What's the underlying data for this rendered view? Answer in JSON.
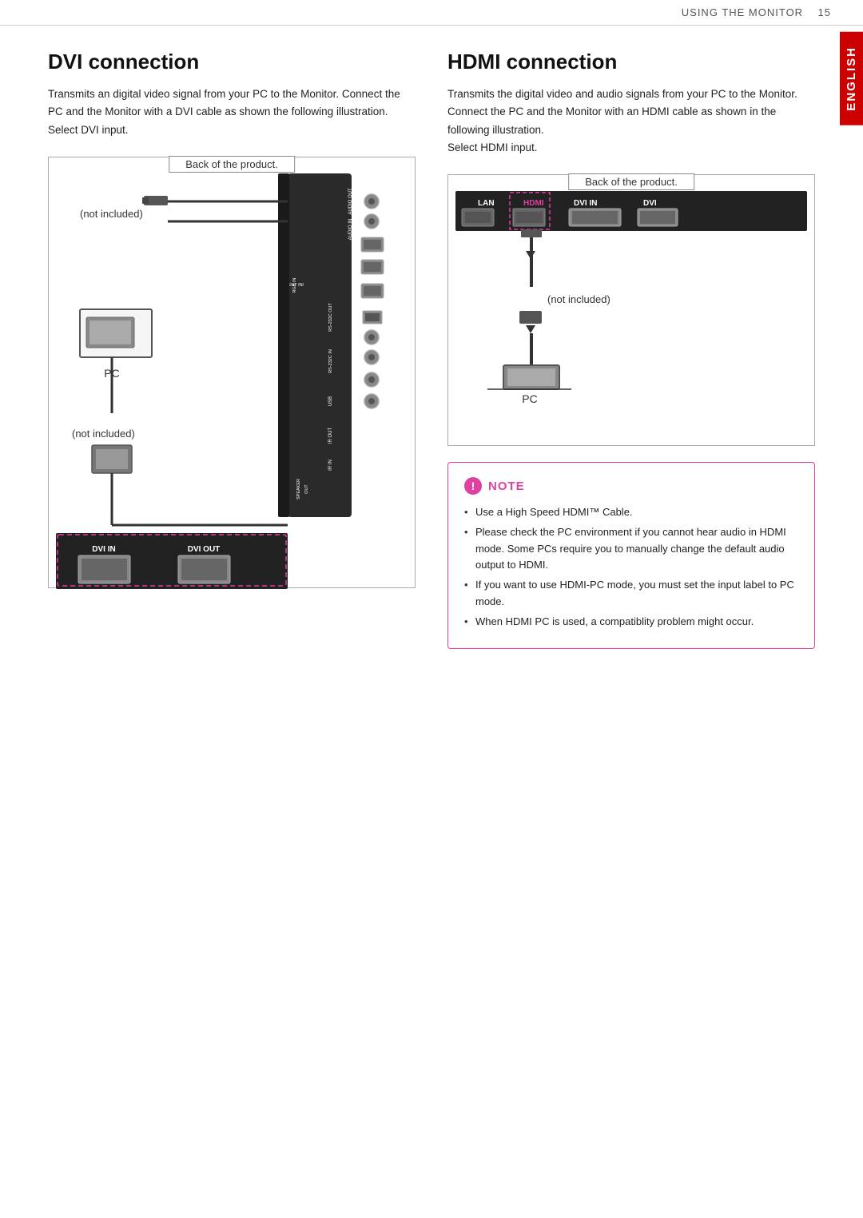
{
  "header": {
    "text": "USING THE MONITOR",
    "page_number": "15"
  },
  "english_tab": "ENGLISH",
  "dvi_section": {
    "title": "DVI connection",
    "description": "Transmits an digital video signal from your PC to the Monitor. Connect the PC and the Monitor with a DVI cable as shown the following illustration. Select DVI input.",
    "diagram_label": "Back of the product.",
    "not_included_1": "(not included)",
    "not_included_2": "(not included)",
    "pc_label": "PC",
    "port_labels": {
      "audio_out": "AUDIO OUT",
      "audio_in": "AUDIO IN",
      "component_rgb": "COMPONENT IN/ RGB IN",
      "rs232c_out": "RS-232C OUT",
      "rs232c_in": "RS-232C IN",
      "usb": "USB",
      "ir_out": "IR OUT",
      "ir_in": "IR IN",
      "speaker_out": "SPEAKER OUT"
    },
    "bottom_labels": {
      "dvi_in": "DVI IN",
      "dvi_out": "DVI OUT"
    }
  },
  "hdmi_section": {
    "title": "HDMI connection",
    "description": "Transmits the digital video and audio signals from your PC to the Monitor. Connect the PC and the Monitor with an HDMI cable as shown in the following illustration.\nSelect HDMI input.",
    "diagram_label": "Back of the product.",
    "not_included": "(not included)",
    "pc_label": "PC",
    "top_labels": {
      "lan": "LAN",
      "hdmi": "HDMI",
      "dvi_in": "DVI IN",
      "dvi": "DVI"
    }
  },
  "note": {
    "title": "NOTE",
    "items": [
      "Use a High Speed HDMI™ Cable.",
      "Please check the PC environment if you cannot hear audio in HDMI mode. Some PCs require you to manually change the default audio output to HDMI.",
      "If you want to use HDMI-PC mode, you must set the input label to PC mode.",
      "When HDMI PC is used, a compatiblity problem might occur."
    ]
  }
}
